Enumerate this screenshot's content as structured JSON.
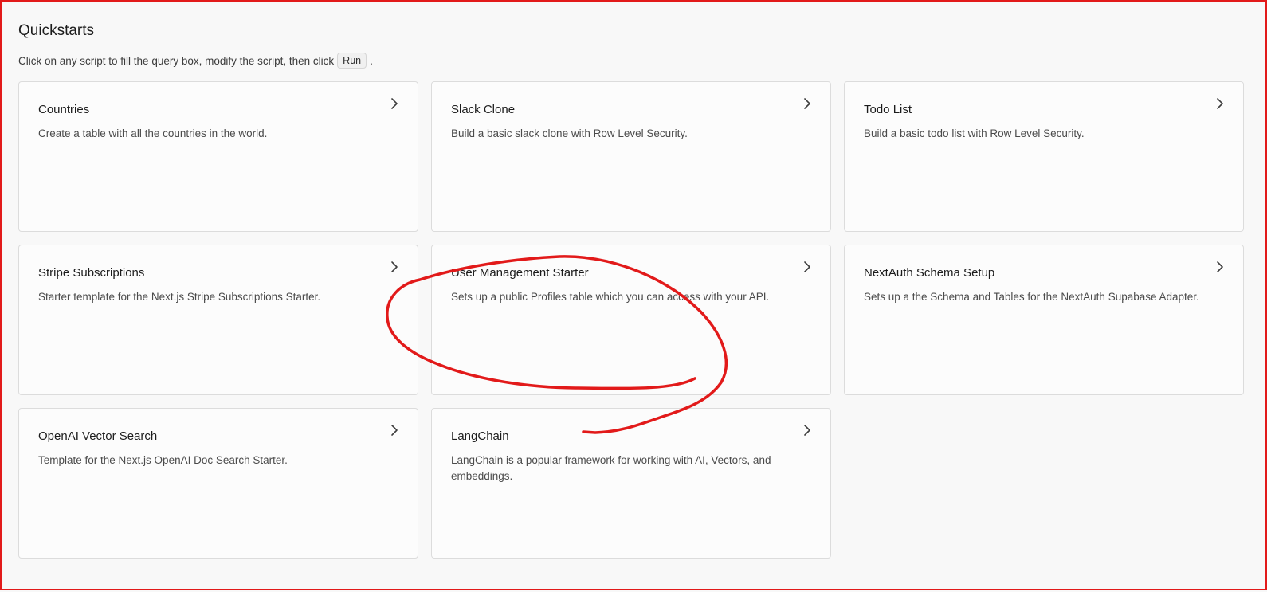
{
  "header": {
    "title": "Quickstarts",
    "description_prefix": "Click on any script to fill the query box, modify the script, then click",
    "run_label": "Run",
    "description_suffix": "."
  },
  "cards": [
    {
      "title": "Countries",
      "description": "Create a table with all the countries in the world.",
      "icon": "chevron-right-icon"
    },
    {
      "title": "Slack Clone",
      "description": "Build a basic slack clone with Row Level Security.",
      "icon": "chevron-right-icon"
    },
    {
      "title": "Todo List",
      "description": "Build a basic todo list with Row Level Security.",
      "icon": "chevron-right-icon"
    },
    {
      "title": "Stripe Subscriptions",
      "description": "Starter template for the Next.js Stripe Subscriptions Starter.",
      "icon": "chevron-right-icon"
    },
    {
      "title": "User Management Starter",
      "description": "Sets up a public Profiles table which you can access with your API.",
      "icon": "chevron-right-icon"
    },
    {
      "title": "NextAuth Schema Setup",
      "description": "Sets up a the Schema and Tables for the NextAuth Supabase Adapter.",
      "icon": "chevron-right-icon"
    },
    {
      "title": "OpenAI Vector Search",
      "description": "Template for the Next.js OpenAI Doc Search Starter.",
      "icon": "chevron-right-icon"
    },
    {
      "title": "LangChain",
      "description": "LangChain is a popular framework for working with AI, Vectors, and embeddings.",
      "icon": "chevron-right-icon"
    }
  ],
  "colors": {
    "frame_border": "#e21a1a",
    "annotation": "#e21a1a",
    "background": "#f8f8f8",
    "card_border": "#dcdcdc"
  }
}
